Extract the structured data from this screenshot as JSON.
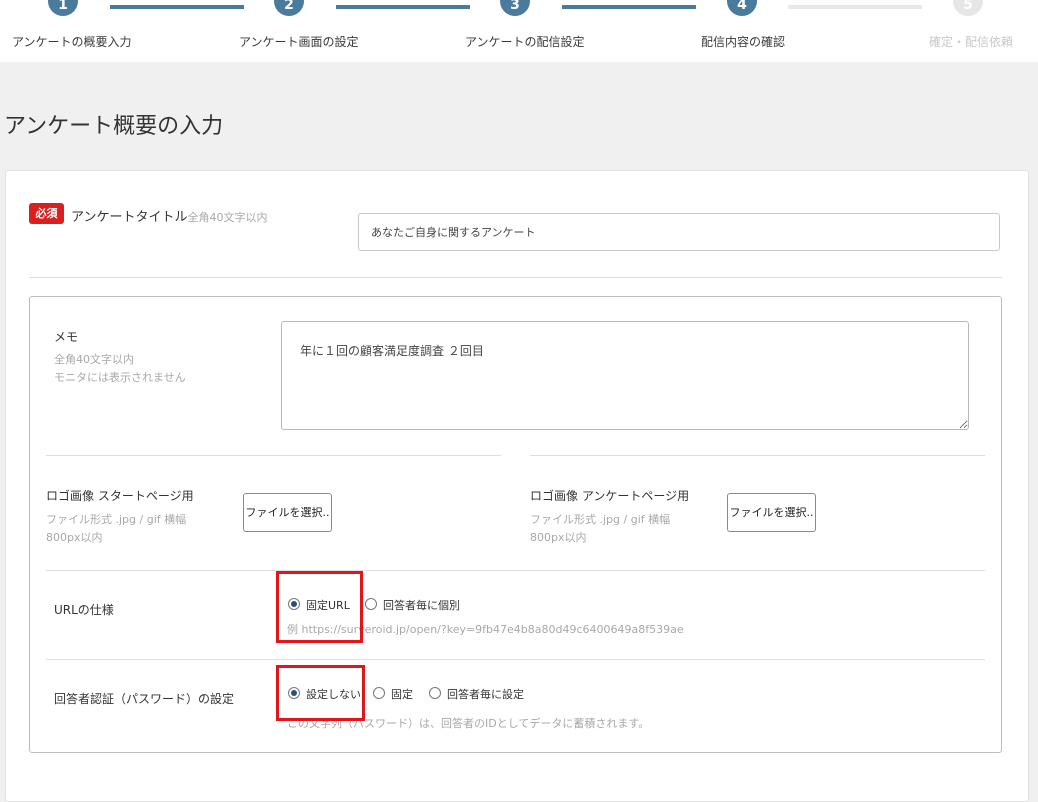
{
  "stepper": {
    "steps": [
      {
        "number": "1",
        "label": "アンケートの概要入力",
        "active": true
      },
      {
        "number": "2",
        "label": "アンケート画面の設定",
        "active": true
      },
      {
        "number": "3",
        "label": "アンケートの配信設定",
        "active": true
      },
      {
        "number": "4",
        "label": "配信内容の確認",
        "active": true
      },
      {
        "number": "5",
        "label": "確定・配信依頼",
        "active": false
      }
    ]
  },
  "page_title": "アンケート概要の入力",
  "form": {
    "title_field": {
      "required_badge": "必須",
      "label": "アンケートタイトル",
      "note": "全角40文字以内",
      "value": "あなたご自身に関するアンケート"
    },
    "memo": {
      "label": "メモ",
      "note_1": "全角40文字以内",
      "note_2": "モニタには表示されません",
      "value": "年に１回の顧客満足度調査 ２回目"
    },
    "logo_start": {
      "label": "ロゴ画像 スタートページ用",
      "note_1": "ファイル形式 .jpg / gif 横幅",
      "note_2": "800px以内",
      "button": "ファイルを選択.."
    },
    "logo_survey": {
      "label": "ロゴ画像 アンケートページ用",
      "note_1": "ファイル形式 .jpg / gif 横幅",
      "note_2": "800px以内",
      "button": "ファイルを選択.."
    },
    "url_spec": {
      "label": "URLの仕様",
      "options": [
        "固定URL",
        "回答者毎に個別"
      ],
      "selected": "固定URL",
      "example": "例 https://surveroid.jp/open/?key=9fb47e4b8a80d49c6400649a8f539ae"
    },
    "auth": {
      "label": "回答者認証（パスワード）の設定",
      "options": [
        "設定しない",
        "固定",
        "回答者毎に設定"
      ],
      "selected": "設定しない",
      "hint": "この文字列（パスワード）は、回答者のIDとしてデータに蓄積されます。"
    }
  },
  "colors": {
    "accent": "#4a7a9c",
    "required": "#d9201f",
    "highlight": "#e0161b",
    "inactive_step": "#e6e6e6"
  }
}
